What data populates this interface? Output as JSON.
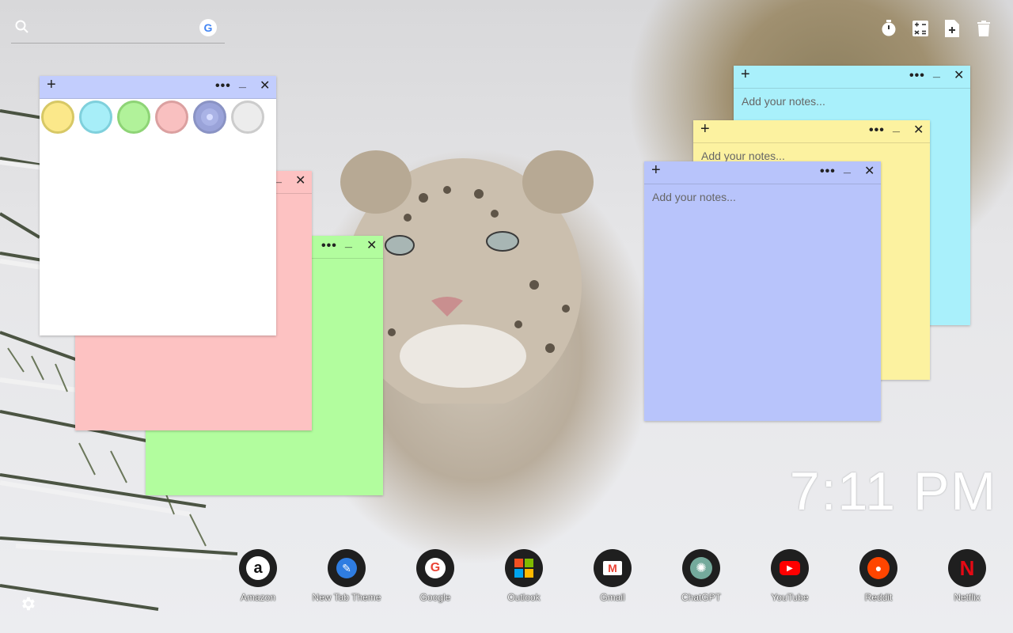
{
  "search": {
    "placeholder": ""
  },
  "toolbar": {
    "icons": [
      "timer-icon",
      "calculator-icon",
      "new-note-icon",
      "trash-icon"
    ]
  },
  "picker_note": {
    "plus": "+",
    "dots": "•••",
    "minimize": "_",
    "close": "✕",
    "swatches": [
      "#fbe88a",
      "#a7eef8",
      "#b1f29a",
      "#f9c0c0",
      "#9aa3d9",
      "#ececec"
    ],
    "swatch_borders": [
      "#d7c865",
      "#7fd0dc",
      "#8ed476",
      "#dba0a0",
      "#8a93c4",
      "#cccccc"
    ]
  },
  "pink_note": {
    "minimize": "_",
    "close": "✕"
  },
  "green_note": {
    "dots": "•••",
    "minimize": "_",
    "close": "✕"
  },
  "cyan_note": {
    "plus": "+",
    "dots": "•••",
    "minimize": "_",
    "close": "✕",
    "placeholder": "Add your notes..."
  },
  "yellow_note": {
    "plus": "+",
    "dots": "•••",
    "minimize": "_",
    "close": "✕",
    "placeholder": "Add your notes..."
  },
  "blue_note": {
    "plus": "+",
    "dots": "•••",
    "minimize": "_",
    "close": "✕",
    "placeholder": "Add your notes..."
  },
  "clock": {
    "time": "7:11 PM"
  },
  "shortcuts": [
    {
      "label": "Amazon",
      "icon": "amazon-icon"
    },
    {
      "label": "New Tab Theme",
      "icon": "new-tab-theme-icon"
    },
    {
      "label": "Google",
      "icon": "google-icon"
    },
    {
      "label": "Outlook",
      "icon": "outlook-icon"
    },
    {
      "label": "Gmail",
      "icon": "gmail-icon"
    },
    {
      "label": "ChatGPT",
      "icon": "chatgpt-icon"
    },
    {
      "label": "YouTube",
      "icon": "youtube-icon"
    },
    {
      "label": "Reddit",
      "icon": "reddit-icon"
    },
    {
      "label": "Netflix",
      "icon": "netflix-icon"
    }
  ],
  "colors": {
    "cyan": "#a9f0fb",
    "yellow": "#fcf2a0",
    "blue": "#b8c4fb",
    "pink": "#fdc2c2",
    "green": "#b2fd9e",
    "picker_header": "#c2cdfd"
  }
}
